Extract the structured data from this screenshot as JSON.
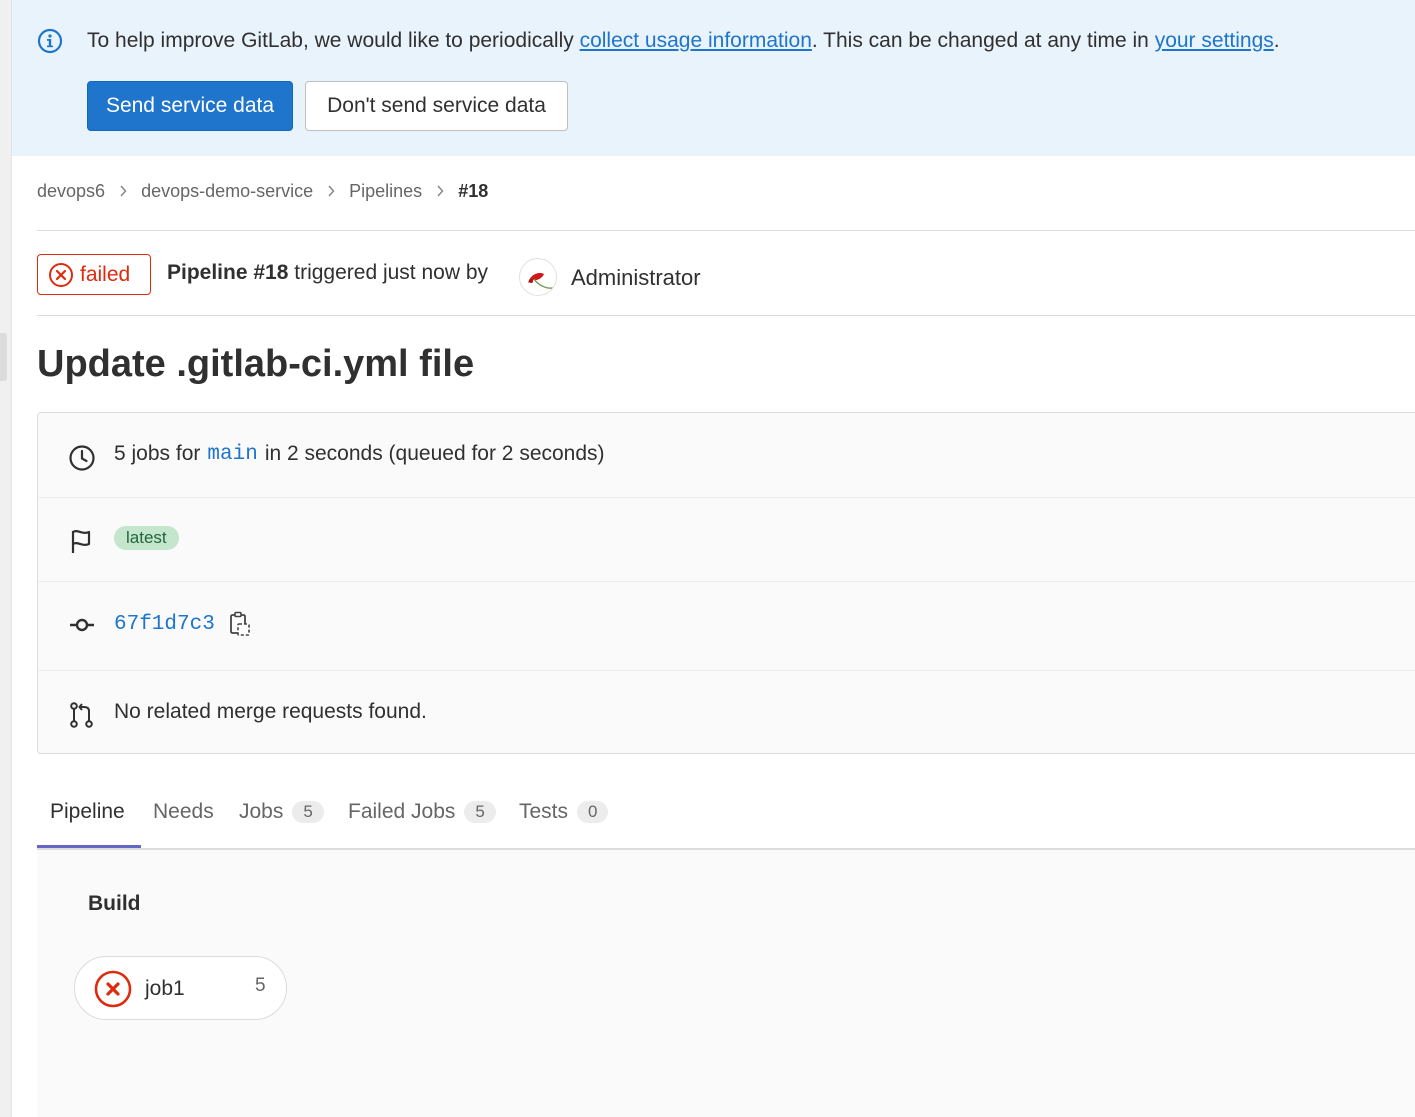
{
  "banner": {
    "text_prefix": "To help improve GitLab, we would like to periodically ",
    "link1": "collect usage information",
    "text_middle": ". This can be changed at any time in ",
    "link2": "your settings",
    "text_suffix": ".",
    "send_label": "Send service data",
    "dont_send_label": "Don't send service data"
  },
  "breadcrumb": {
    "items": [
      "devops6",
      "devops-demo-service",
      "Pipelines",
      "#18"
    ]
  },
  "header": {
    "status": "failed",
    "pipeline_label": "Pipeline #18",
    "triggered_text": " triggered just now by",
    "user": "Administrator"
  },
  "title": "Update .gitlab-ci.yml file",
  "info": {
    "jobs_prefix": "5 jobs for",
    "branch": "main",
    "jobs_suffix": "in 2 seconds (queued for 2 seconds)",
    "tag": "latest",
    "commit": "67f1d7c3",
    "merge_requests": "No related merge requests found."
  },
  "tabs": [
    {
      "label": "Pipeline",
      "count": null
    },
    {
      "label": "Needs",
      "count": null
    },
    {
      "label": "Jobs",
      "count": "5"
    },
    {
      "label": "Failed Jobs",
      "count": "5"
    },
    {
      "label": "Tests",
      "count": "0"
    }
  ],
  "graph": {
    "stage": "Build",
    "job_name": "job1",
    "job_count": "5"
  },
  "colors": {
    "primary": "#1f75cb",
    "danger": "#dd2b0e",
    "banner_bg": "#e9f3fc",
    "latest_bg": "#c3e6cd"
  },
  "icons": [
    "information-icon",
    "clock-icon",
    "flag-icon",
    "commit-icon",
    "copy-clipboard-icon",
    "merge-request-icon",
    "status-failed-icon",
    "chevron-right-icon"
  ]
}
